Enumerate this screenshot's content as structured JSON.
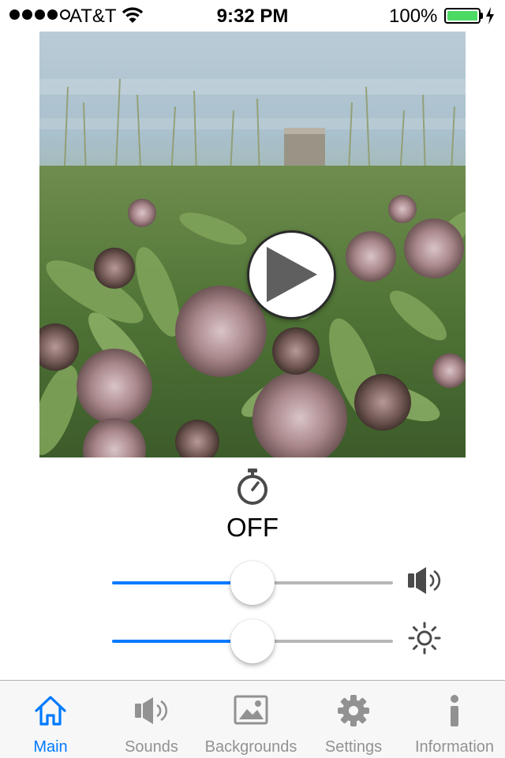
{
  "status_bar": {
    "carrier": "AT&T",
    "time": "9:32 PM",
    "battery": "100%",
    "signal_bars_filled": 4,
    "signal_bars_total": 5
  },
  "player": {
    "background_scene": "milkweed flowers by a lake",
    "play_icon": "play-icon"
  },
  "timer": {
    "icon": "stopwatch-icon",
    "label": "OFF"
  },
  "volume": {
    "icon": "speaker-icon",
    "value": 0.5
  },
  "brightness": {
    "icon": "sun-icon",
    "value": 0.5
  },
  "tabs": [
    {
      "label": "Main",
      "icon": "home-icon",
      "active": true
    },
    {
      "label": "Sounds",
      "icon": "speaker-icon",
      "active": false
    },
    {
      "label": "Backgrounds",
      "icon": "picture-icon",
      "active": false
    },
    {
      "label": "Settings",
      "icon": "gear-icon",
      "active": false
    },
    {
      "label": "Information",
      "icon": "info-icon",
      "active": false
    }
  ],
  "colors": {
    "accent": "#007aff",
    "inactive": "#929292",
    "battery": "#4cd964"
  }
}
